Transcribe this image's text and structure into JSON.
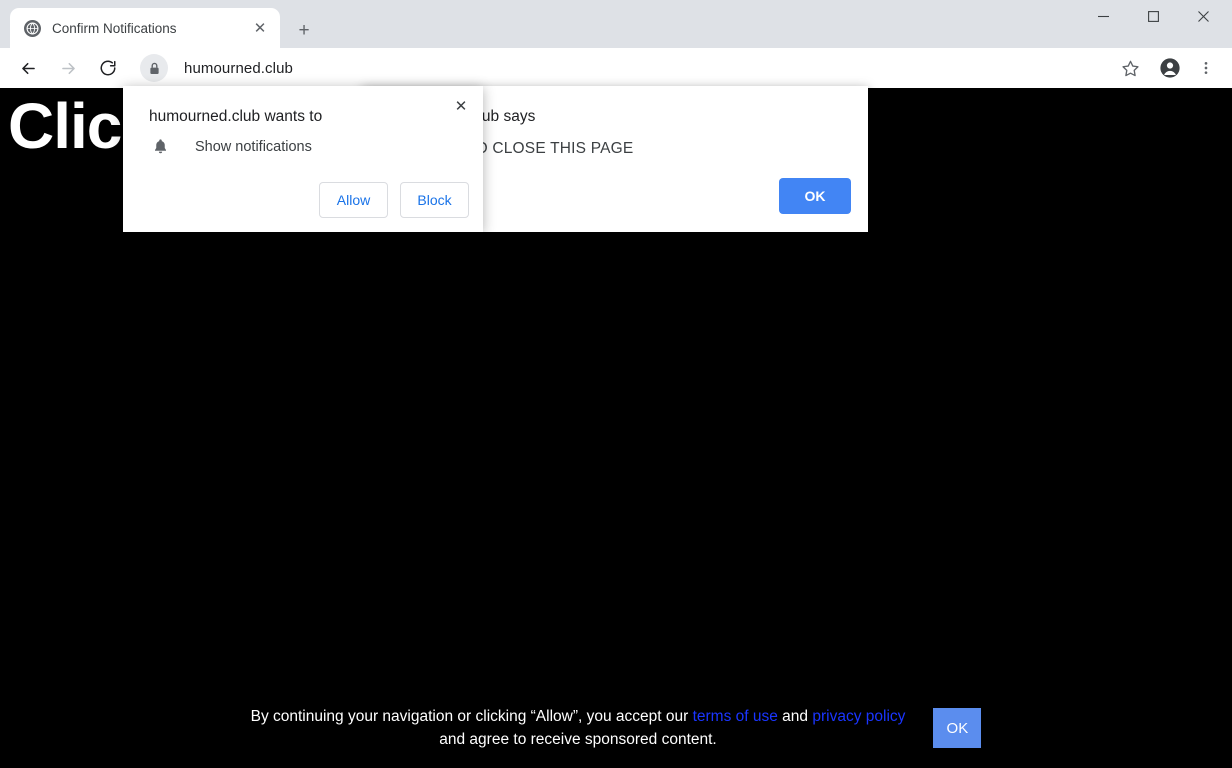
{
  "window": {
    "minimize_label": "Minimize",
    "maximize_label": "Maximize",
    "close_label": "Close"
  },
  "tabstrip": {
    "tab_title": "Confirm Notifications",
    "tab_close_glyph": "✕",
    "new_tab_glyph": "+"
  },
  "toolbar": {
    "url": "humourned.club",
    "back_label": "Back",
    "forward_label": "Forward",
    "reload_label": "Reload",
    "bookmark_label": "Bookmark this tab",
    "profile_label": "Profile",
    "menu_label": "Customize and control Google Chrome"
  },
  "page": {
    "headline": "Click  HERE  if  you are not",
    "background_color": "#000000",
    "consent": {
      "line1_before": "By continuing your navigation or clicking “Allow”, you accept our ",
      "terms_link": "terms of use",
      "line1_between": " and ",
      "privacy_link": "privacy policy",
      "line2": "and agree to receive sponsored content.",
      "ok_label": "OK",
      "ok_color": "#5b8dee",
      "link_color": "#1a35ff"
    }
  },
  "js_dialog": {
    "title": "humourned.club says",
    "message": "CLICK OK TO CLOSE THIS PAGE",
    "ok_label": "OK",
    "ok_color": "#4285f4"
  },
  "permission_bubble": {
    "title": "humourned.club wants to",
    "permission_label": "Show notifications",
    "allow_label": "Allow",
    "block_label": "Block",
    "close_glyph": "✕",
    "button_text_color": "#1a73e8"
  }
}
